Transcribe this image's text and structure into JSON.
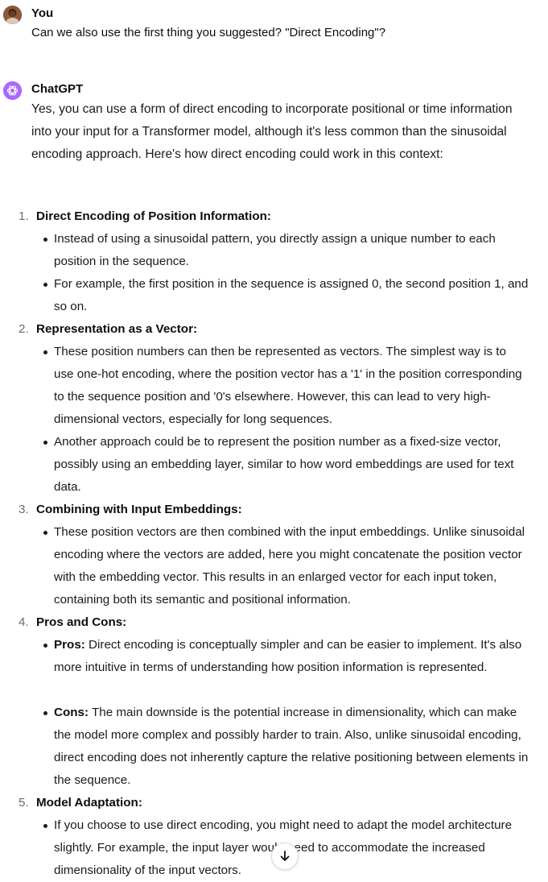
{
  "user_message": {
    "author": "You",
    "text": "Can we also use the first thing you suggested? \"Direct Encoding\"?"
  },
  "assistant_message": {
    "author": "ChatGPT",
    "intro": "Yes, you can use a form of direct encoding to incorporate positional or time information into your input for a Transformer model, although it's less common than the sinusoidal encoding approach. Here's how direct encoding could work in this context:",
    "items": [
      {
        "num": "1.",
        "title": "Direct Encoding of Position Information:",
        "bullets": [
          {
            "label": "",
            "text": "Instead of using a sinusoidal pattern, you directly assign a unique number to each position in the sequence."
          },
          {
            "label": "",
            "text": "For example, the first position in the sequence is assigned 0, the second position 1, and so on."
          }
        ]
      },
      {
        "num": "2.",
        "title": "Representation as a Vector:",
        "bullets": [
          {
            "label": "",
            "text": "These position numbers can then be represented as vectors. The simplest way is to use one-hot encoding, where the position vector has a '1' in the position corresponding to the sequence position and '0's elsewhere. However, this can lead to very high-dimensional vectors, especially for long sequences."
          },
          {
            "label": "",
            "text": "Another approach could be to represent the position number as a fixed-size vector, possibly using an embedding layer, similar to how word embeddings are used for text data."
          }
        ]
      },
      {
        "num": "3.",
        "title": "Combining with Input Embeddings:",
        "bullets": [
          {
            "label": "",
            "text": "These position vectors are then combined with the input embeddings. Unlike sinusoidal encoding where the vectors are added, here you might concatenate the position vector with the embedding vector. This results in an enlarged vector for each input token, containing both its semantic and positional information."
          }
        ]
      },
      {
        "num": "4.",
        "title": "Pros and Cons:",
        "bullets": [
          {
            "label": "Pros:",
            "text": " Direct encoding is conceptually simpler and can be easier to implement. It's also more intuitive in terms of understanding how position information is represented."
          },
          {
            "label": "Cons:",
            "text": " The main downside is the potential increase in dimensionality, which can make the model more complex and possibly harder to train. Also, unlike sinusoidal encoding, direct encoding does not inherently capture the relative positioning between elements in the sequence."
          }
        ]
      },
      {
        "num": "5.",
        "title": "Model Adaptation:",
        "bullets": [
          {
            "label": "",
            "text": "If you choose to use direct encoding, you might need to adapt the model architecture slightly. For example, the input layer would need to accommodate the increased dimensionality of the input vectors."
          }
        ]
      }
    ]
  },
  "icons": {
    "user_avatar": "user-avatar-photo",
    "assistant_avatar": "openai-logo-icon",
    "scroll_down": "arrow-down-icon"
  },
  "colors": {
    "assistant_avatar_bg": "#ab68ff",
    "text": "#0d0d0d",
    "list_number": "#6b6b6b"
  }
}
